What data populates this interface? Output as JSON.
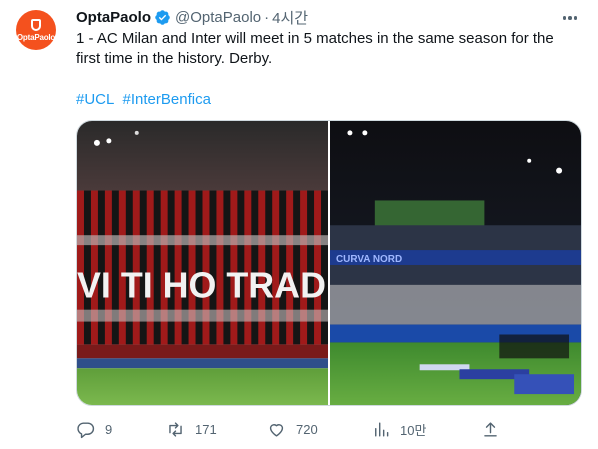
{
  "author": {
    "display_name": "OptaPaolo",
    "handle": "@OptaPaolo",
    "separator": "·",
    "time": "4시간",
    "avatar_text": "OptaPaolo"
  },
  "tweet": {
    "text": "1 - AC Milan and Inter will meet in 5 matches in the same season for the first time in the history. Derby.",
    "hashtags": [
      "#UCL",
      "#InterBenfica"
    ]
  },
  "media": {
    "left_photo_banner": "VI TI HO TRAD",
    "right_photo_banner": "CURVA NORD"
  },
  "actions": {
    "replies": "9",
    "retweets": "171",
    "likes": "720",
    "views": "10만"
  },
  "colors": {
    "brand": "#f4511e",
    "link": "#1d9bf0",
    "muted": "#536471",
    "text": "#0f1419"
  }
}
